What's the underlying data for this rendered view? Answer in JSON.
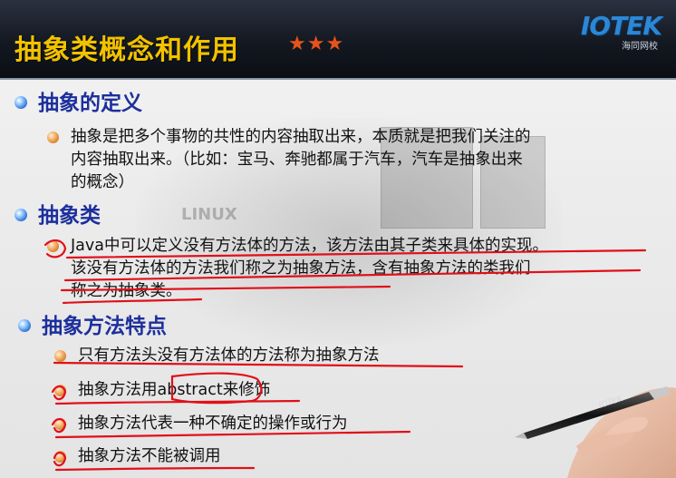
{
  "header": {
    "title": "抽象类概念和作用",
    "stars": "★★★",
    "logo_text": "IOTEK",
    "logo_sub": "海同网校"
  },
  "background": {
    "watermark_text": "LINUX"
  },
  "sections": [
    {
      "heading": "抽象的定义",
      "items": [
        {
          "lines": [
            "抽象是把多个事物的共性的内容抽取出来，本质就是把我们关注的",
            "内容抽取出来。（比如：宝马、奔驰都属于汽车，汽车是抽象出来",
            "的概念）"
          ]
        }
      ]
    },
    {
      "heading": "抽象类",
      "items": [
        {
          "lines": [
            "Java中可以定义没有方法体的方法，该方法由其子类来具体的实现。",
            "该没有方法体的方法我们称之为抽象方法，含有抽象方法的类我们",
            "称之为抽象类。"
          ]
        }
      ]
    },
    {
      "heading": "抽象方法特点",
      "items": [
        {
          "lines": [
            "只有方法头没有方法体的方法称为抽象方法"
          ]
        },
        {
          "lines": [
            "抽象方法用abstract来修饰"
          ]
        },
        {
          "lines": [
            "抽象方法代表一种不确定的操作或行为"
          ]
        },
        {
          "lines": [
            "抽象方法不能被调用"
          ]
        }
      ]
    }
  ],
  "pen_brand": "IOTEK",
  "colors": {
    "title": "#f2c200",
    "heading": "#1c2f9c",
    "ink": "#e0101a",
    "stars": "#e8531a"
  }
}
